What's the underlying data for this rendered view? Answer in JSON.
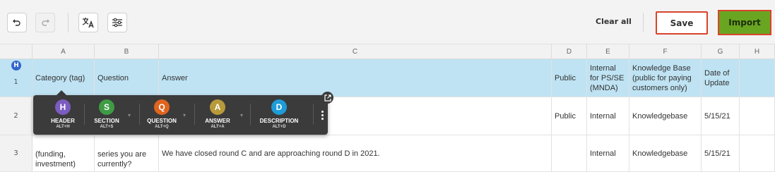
{
  "toolbar": {
    "undo_icon": "undo-icon",
    "redo_icon": "redo-icon",
    "translate_icon": "translate-icon",
    "settings_icon": "sliders-icon",
    "clear_all_label": "Clear all",
    "save_label": "Save",
    "import_label": "Import"
  },
  "colors": {
    "import_bg": "#6aa522",
    "highlight_border": "#d9432c",
    "header_row_bg": "#bfe3f3"
  },
  "columns": [
    "A",
    "B",
    "C",
    "D",
    "E",
    "F",
    "G",
    "H"
  ],
  "rows": [
    {
      "num": "1",
      "badge": "H",
      "cells": [
        "Category (tag)",
        "Question",
        "Answer",
        "Public",
        "Internal for PS/SE (MNDA)",
        "Knowledge Base (public for paying customers only)",
        "Date of Update",
        ""
      ]
    },
    {
      "num": "2",
      "cells": [
        "",
        "",
        "",
        "Public",
        "Internal",
        "Knowledgebase",
        "5/15/21",
        ""
      ]
    },
    {
      "num": "3",
      "cells": [
        "(funding, investment)",
        "series you are currently?",
        "We have closed round C and are approaching round D in 2021.",
        "",
        "Internal",
        "Knowledgebase",
        "5/15/21",
        ""
      ]
    }
  ],
  "popup": {
    "types": [
      {
        "letter": "H",
        "label": "HEADER",
        "shortcut": "ALT+H",
        "color": "#7b5cc0"
      },
      {
        "letter": "S",
        "label": "SECTION",
        "shortcut": "ALT+S",
        "color": "#3f9c45"
      },
      {
        "letter": "Q",
        "label": "QUESTION",
        "shortcut": "ALT+Q",
        "color": "#e0641e"
      },
      {
        "letter": "A",
        "label": "ANSWER",
        "shortcut": "ALT+A",
        "color": "#b89a3a"
      },
      {
        "letter": "D",
        "label": "DESCRIPTION",
        "shortcut": "ALT+D",
        "color": "#1e9cd8"
      }
    ],
    "more_icon": "more-vertical-icon",
    "popout_icon": "open-external-icon"
  }
}
